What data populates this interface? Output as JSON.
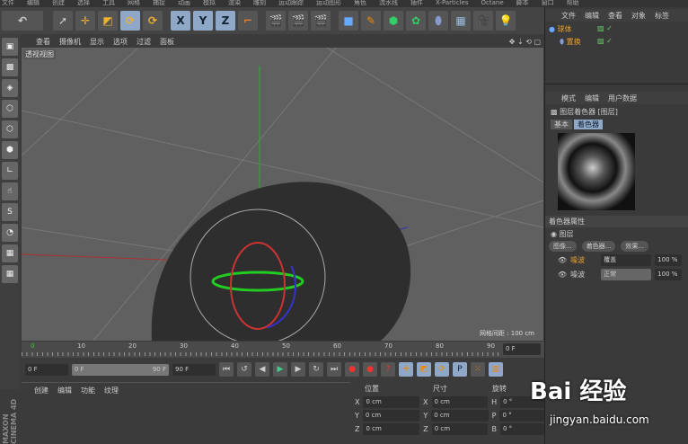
{
  "menubar": [
    "文件",
    "编辑",
    "创建",
    "选择",
    "工具",
    "网格",
    "捕捉",
    "动画",
    "模拟",
    "渲染",
    "雕刻",
    "运动跟踪",
    "运动图形",
    "角色",
    "流水线",
    "插件",
    "X-Particles",
    "Octane",
    "脚本",
    "窗口",
    "帮助"
  ],
  "toolbar": {
    "x": "X",
    "y": "Y",
    "z": "Z"
  },
  "viewport": {
    "menu": [
      "查看",
      "摄像机",
      "显示",
      "选项",
      "过滤",
      "面板"
    ],
    "label": "透视视图",
    "grid": "网格间距 : 100 cm"
  },
  "timeline": {
    "ticks": [
      "0",
      "10",
      "20",
      "30",
      "40",
      "50",
      "60",
      "70",
      "80",
      "90"
    ],
    "current": "0 F"
  },
  "controls": {
    "start": "0 F",
    "range_start": "0 F",
    "range_end": "90 F",
    "end": "90 F"
  },
  "material_manager": {
    "menu": [
      "创建",
      "编辑",
      "功能",
      "纹理"
    ]
  },
  "coords": {
    "headers": [
      "位置",
      "尺寸",
      "旋转"
    ],
    "rows": [
      [
        "X",
        "0 cm",
        "X",
        "0 cm",
        "H",
        "0 °"
      ],
      [
        "Y",
        "0 cm",
        "Y",
        "0 cm",
        "P",
        "0 °"
      ],
      [
        "Z",
        "0 cm",
        "Z",
        "0 cm",
        "B",
        "0 °"
      ]
    ]
  },
  "brand": "MAXON CINEMA 4D",
  "objects": {
    "menu": [
      "文件",
      "编辑",
      "查看",
      "对象",
      "标签"
    ],
    "items": [
      "球体",
      "置换"
    ]
  },
  "attributes": {
    "menu": [
      "模式",
      "编辑",
      "用户数据"
    ],
    "title": "图层着色器 [图层]",
    "tabs": [
      "基本",
      "着色器"
    ],
    "section": "着色器属性",
    "group": "图层",
    "buttons": [
      "图像...",
      "着色器...",
      "效果..."
    ],
    "layers": [
      {
        "name": "噪波",
        "mode": "覆盖",
        "pct": "100 %"
      },
      {
        "name": "噪波",
        "mode": "正常",
        "pct": "100 %"
      }
    ]
  },
  "watermark": {
    "logo": "Bai 经验",
    "url": "jingyan.baidu.com"
  }
}
